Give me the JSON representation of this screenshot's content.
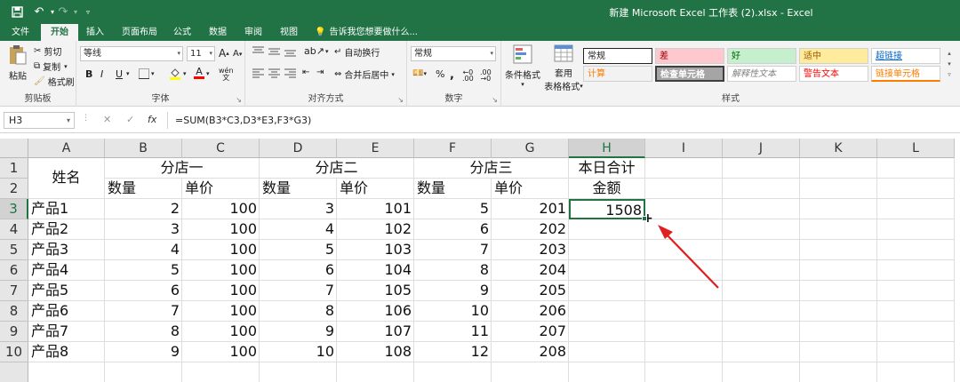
{
  "titlebar": {
    "title": "新建 Microsoft Excel 工作表 (2).xlsx - Excel",
    "save_icon": "save-icon",
    "undo_icon": "undo-icon",
    "redo_icon": "redo-icon",
    "customize_icon": "customize-icon"
  },
  "tabs": [
    "文件",
    "开始",
    "插入",
    "页面布局",
    "公式",
    "数据",
    "审阅",
    "视图"
  ],
  "tell_me": "告诉我您想要做什么...",
  "ribbon": {
    "clipboard": {
      "paste": "粘贴",
      "cut": "剪切",
      "copy": "复制",
      "format_painter": "格式刷",
      "label": "剪贴板"
    },
    "font": {
      "name": "等线",
      "size": "11",
      "grow": "A",
      "shrink": "A",
      "bold": "B",
      "italic": "I",
      "underline": "U",
      "phonetic": "wén",
      "label": "字体"
    },
    "alignment": {
      "wrap": "自动换行",
      "merge": "合并后居中",
      "label": "对齐方式"
    },
    "number": {
      "format": "常规",
      "percent": "%",
      "comma": ",",
      "label": "数字"
    },
    "styles": {
      "conditional": "条件格式",
      "table": "套用",
      "table2": "表格格式",
      "label": "样式",
      "cells": [
        {
          "text": "常规",
          "bg": "#ffffff",
          "color": "#222222"
        },
        {
          "text": "差",
          "bg": "#ffc7ce",
          "color": "#9c0006"
        },
        {
          "text": "好",
          "bg": "#c6efce",
          "color": "#006100"
        },
        {
          "text": "适中",
          "bg": "#ffeb9c",
          "color": "#9c5700"
        },
        {
          "text": "超链接",
          "bg": "#ffffff",
          "color": "#0563c1"
        },
        {
          "text": "计算",
          "bg": "#f2f2f2",
          "color": "#fa7d00"
        },
        {
          "text": "检查单元格",
          "bg": "#a5a5a5",
          "color": "#ffffff"
        },
        {
          "text": "解释性文本",
          "bg": "#ffffff",
          "color": "#7f7f7f"
        },
        {
          "text": "警告文本",
          "bg": "#ffffff",
          "color": "#ff0000"
        },
        {
          "text": "链接单元格",
          "bg": "#ffffff",
          "color": "#fa7d00"
        }
      ]
    }
  },
  "formula_bar": {
    "name_box": "H3",
    "cancel": "✕",
    "enter": "✓",
    "fx": "fx",
    "formula": "=SUM(B3*C3,D3*E3,F3*G3)"
  },
  "columns": [
    "A",
    "B",
    "C",
    "D",
    "E",
    "F",
    "G",
    "H",
    "I",
    "J",
    "K",
    "L"
  ],
  "rows": [
    "1",
    "2",
    "3",
    "4",
    "5",
    "6",
    "7",
    "8",
    "9",
    "10"
  ],
  "headers": {
    "name": "姓名",
    "store1": "分店一",
    "store2": "分店二",
    "store3": "分店三",
    "total": "本日合计",
    "amount": "金额",
    "qty": "数量",
    "price": "单价"
  },
  "products": [
    {
      "name": "产品1",
      "b": 2,
      "c": 100,
      "d": 3,
      "e": 101,
      "f": 5,
      "g": 201,
      "h": "1508"
    },
    {
      "name": "产品2",
      "b": 3,
      "c": 100,
      "d": 4,
      "e": 102,
      "f": 6,
      "g": 202,
      "h": ""
    },
    {
      "name": "产品3",
      "b": 4,
      "c": 100,
      "d": 5,
      "e": 103,
      "f": 7,
      "g": 203,
      "h": ""
    },
    {
      "name": "产品4",
      "b": 5,
      "c": 100,
      "d": 6,
      "e": 104,
      "f": 8,
      "g": 204,
      "h": ""
    },
    {
      "name": "产品5",
      "b": 6,
      "c": 100,
      "d": 7,
      "e": 105,
      "f": 9,
      "g": 205,
      "h": ""
    },
    {
      "name": "产品6",
      "b": 7,
      "c": 100,
      "d": 8,
      "e": 106,
      "f": 10,
      "g": 206,
      "h": ""
    },
    {
      "name": "产品7",
      "b": 8,
      "c": 100,
      "d": 9,
      "e": 107,
      "f": 11,
      "g": 207,
      "h": ""
    },
    {
      "name": "产品8",
      "b": 9,
      "c": 100,
      "d": 10,
      "e": 108,
      "f": 12,
      "g": 208,
      "h": ""
    }
  ],
  "selected_cell": "H3",
  "accent": "#217346",
  "arrow_color": "#e02020"
}
